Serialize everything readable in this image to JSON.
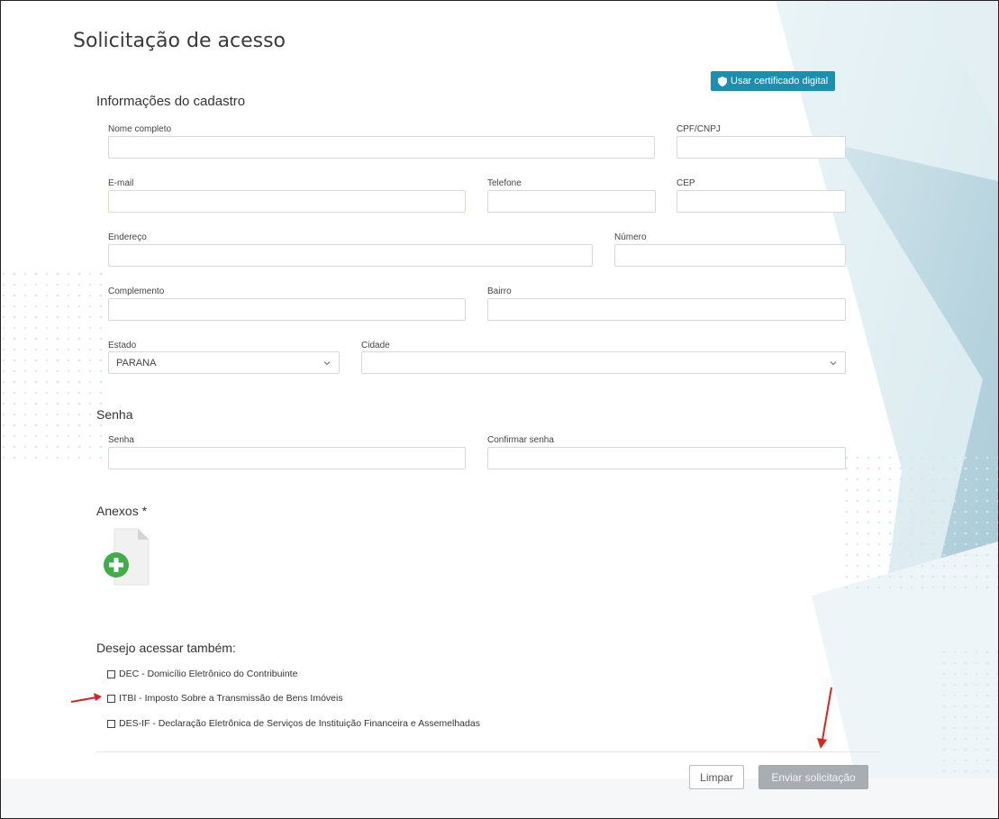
{
  "page": {
    "title": "Solicitação de acesso",
    "cert_button_label": "Usar certificado digital"
  },
  "sections": {
    "registration": "Informações do cadastro",
    "password": "Senha",
    "attachments": "Anexos *",
    "extra_access": "Desejo acessar também:"
  },
  "fields": {
    "full_name": {
      "label": "Nome completo",
      "value": ""
    },
    "cpf_cnpj": {
      "label": "CPF/CNPJ",
      "value": ""
    },
    "email": {
      "label": "E-mail",
      "value": ""
    },
    "phone": {
      "label": "Telefone",
      "value": ""
    },
    "cep": {
      "label": "CEP",
      "value": ""
    },
    "address": {
      "label": "Endereço",
      "value": ""
    },
    "number": {
      "label": "Número",
      "value": ""
    },
    "complement": {
      "label": "Complemento",
      "value": ""
    },
    "district": {
      "label": "Bairro",
      "value": ""
    },
    "state": {
      "label": "Estado",
      "value": "PARANA"
    },
    "city": {
      "label": "Cidade",
      "value": ""
    },
    "password": {
      "label": "Senha",
      "value": ""
    },
    "password_confirm": {
      "label": "Confirmar senha",
      "value": ""
    }
  },
  "options": [
    {
      "label": "DEC - Domicílio Eletrônico do Contribuinte",
      "checked": false
    },
    {
      "label": "ITBI - Imposto Sobre a Transmissão de Bens Imóveis",
      "checked": false
    },
    {
      "label": "DES-IF - Declaração Eletrônica de Serviços de Instituição Financeira e Assemelhadas",
      "checked": false
    }
  ],
  "buttons": {
    "clear": "Limpar",
    "send": "Enviar solicitação"
  },
  "colors": {
    "accent": "#1b8fb0",
    "send_disabled": "#a8adb2",
    "annotation_arrow": "#e0201e",
    "attach_plus": "#3fae49"
  }
}
